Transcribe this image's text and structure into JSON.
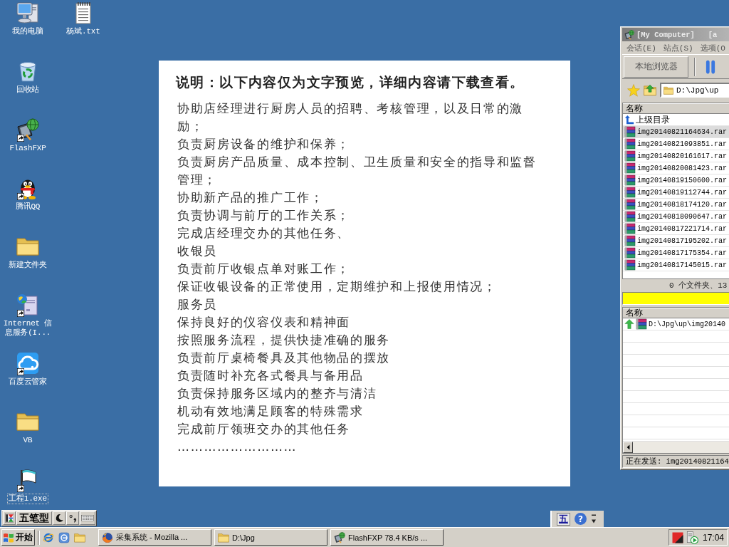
{
  "desktop_columns": [
    {
      "icons": [
        {
          "label": "我的电脑",
          "kind": "computer",
          "shortcut": false,
          "focused": false
        },
        {
          "label": "回收站",
          "kind": "recycle-bin",
          "shortcut": false,
          "focused": false
        },
        {
          "label": "FlashFXP",
          "kind": "flashfxp",
          "shortcut": true,
          "focused": false
        },
        {
          "label": "腾讯QQ",
          "kind": "penguin",
          "shortcut": true,
          "focused": false
        },
        {
          "label": "新建文件夹",
          "kind": "folder",
          "shortcut": false,
          "focused": false
        },
        {
          "label": "Internet 信息服务(I...",
          "kind": "server",
          "shortcut": true,
          "focused": false
        },
        {
          "label": "百度云管家",
          "kind": "cloud",
          "shortcut": true,
          "focused": false
        },
        {
          "label": "VB",
          "kind": "folder",
          "shortcut": false,
          "focused": false
        },
        {
          "label": "工程1.exe",
          "kind": "flag",
          "shortcut": true,
          "focused": true
        }
      ]
    },
    {
      "icons": [
        {
          "label": "杨斌.txt",
          "kind": "text-file",
          "shortcut": false,
          "focused": false
        }
      ]
    }
  ],
  "document": {
    "title": "说明：以下内容仅为文字预览，详细内容请下载查看。",
    "paragraphs": [
      "协助店经理进行厨房人员的招聘、考核管理，以及日常的激励；",
      "负责厨房设备的维护和保养；",
      "负责厨房产品质量、成本控制、卫生质量和安全的指导和监督管理；",
      "协助新产品的推广工作；",
      "负责协调与前厅的工作关系；",
      "完成店经理交办的其他任务、",
      "收银员",
      "负责前厅收银点单对账工作；",
      "保证收银设备的正常使用，定期维护和上报使用情况；",
      "服务员",
      "保持良好的仪容仪表和精神面",
      "按照服务流程，提供快捷准确的服务",
      "负责前厅桌椅餐具及其他物品的摆放",
      "负责随时补充各式餐具与备用品",
      "负责保持服务区域内的整齐与清洁",
      "机动有效地满足顾客的特殊需求",
      "完成前厅领班交办的其他任务",
      "………………………"
    ]
  },
  "ftp_window": {
    "title": "[My Computer]   [a",
    "menu": [
      "会话(E)",
      "站点(S)",
      "选项(O"
    ],
    "toolbar_button": "本地浏览器",
    "path": "D:\\Jpg\\up",
    "list_header": "名称",
    "parent_dir": "上级目录",
    "files": [
      {
        "name": "img20140821164634.rar",
        "selected": true
      },
      {
        "name": "img20140821093851.rar",
        "selected": false
      },
      {
        "name": "img20140820161617.rar",
        "selected": false
      },
      {
        "name": "img20140820081423.rar",
        "selected": false
      },
      {
        "name": "img20140819150600.rar",
        "selected": false
      },
      {
        "name": "img20140819112744.rar",
        "selected": false
      },
      {
        "name": "img20140818174120.rar",
        "selected": false
      },
      {
        "name": "img20140818090647.rar",
        "selected": false
      },
      {
        "name": "img20140817221714.rar",
        "selected": false
      },
      {
        "name": "img20140817195202.rar",
        "selected": false
      },
      {
        "name": "img20140817175354.rar",
        "selected": false
      },
      {
        "name": "img20140817145015.rar",
        "selected": false
      }
    ],
    "file_count": "0 个文件夹、13",
    "queue_header": "名称",
    "queue": [
      "D:\\Jpg\\up\\img20140"
    ],
    "status": "正在发送: img20140821164"
  },
  "ime_bar": {
    "mode": "五笔型"
  },
  "language_bar": {
    "ime": "五",
    "help": "?"
  },
  "taskbar": {
    "start": "开始",
    "tasks": [
      {
        "label": "采集系统 - Mozilla ...",
        "kind": "firefox",
        "selected": false
      },
      {
        "label": "D:\\Jpg",
        "kind": "folder",
        "selected": false
      },
      {
        "label": "FlashFXP 78.4 KB/s ...",
        "kind": "flashfxp",
        "selected": false
      }
    ],
    "clock": "17:04"
  }
}
